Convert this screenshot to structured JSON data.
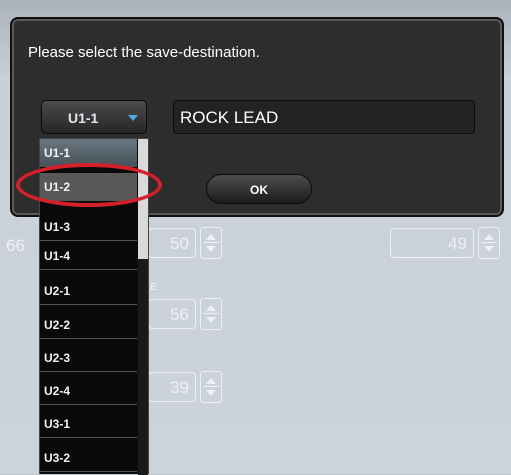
{
  "dialog": {
    "prompt": "Please select the save-destination.",
    "ok_label": "OK",
    "name_value": "ROCK LEAD"
  },
  "destination_select": {
    "selected": "U1-1",
    "options": [
      "U1-1",
      "U1-2",
      "U1-3",
      "U1-4",
      "U2-1",
      "U2-2",
      "U2-3",
      "U2-4",
      "U3-1",
      "U3-2"
    ],
    "highlighted": "U1-2"
  },
  "background": {
    "values": [
      "66",
      "50",
      "49",
      "56",
      "39"
    ],
    "faint_label": "E"
  },
  "colors": {
    "dialog_bg": "#2d2d2d",
    "select_arrow": "#4fa8e6",
    "highlight_ring": "#d4202b"
  },
  "icons": [
    "chevron-down-icon",
    "spin-up-icon",
    "spin-down-icon"
  ]
}
